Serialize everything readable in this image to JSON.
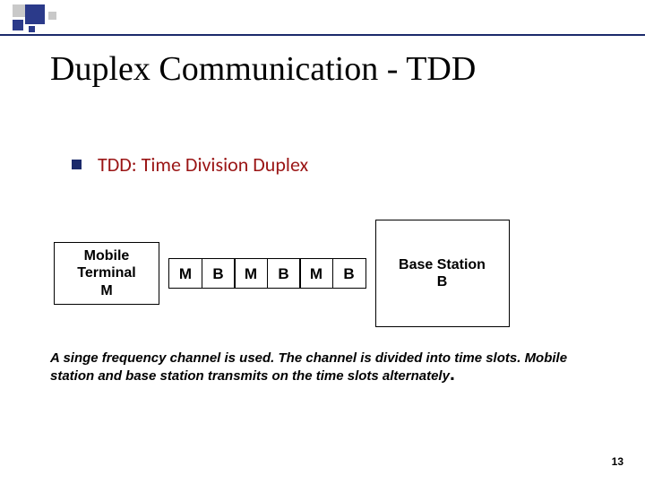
{
  "title": "Duplex Communication - TDD",
  "bullet": "TDD: Time Division Duplex",
  "left_node": {
    "line1": "Mobile",
    "line2": "Terminal",
    "line3": "M"
  },
  "right_node": {
    "line1": "Base Station",
    "line2": "B"
  },
  "slots": [
    "M",
    "B",
    "M",
    "B",
    "M",
    "B"
  ],
  "explanation": "A singe frequency channel is used. The channel is divided into time slots. Mobile station and base station transmits on the time slots alternately",
  "page_number": "13"
}
